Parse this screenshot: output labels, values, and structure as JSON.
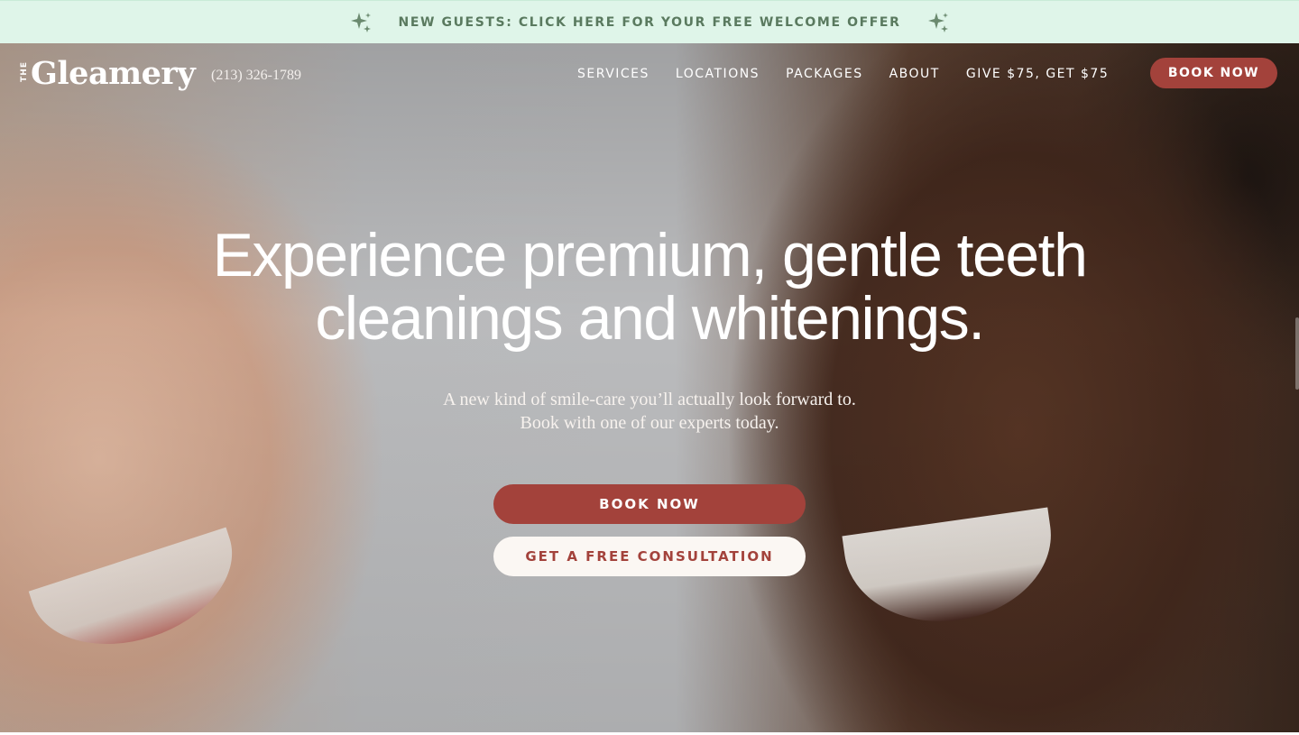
{
  "promo": {
    "text": "NEW GUESTS: CLICK HERE FOR YOUR FREE WELCOME OFFER",
    "icon": "sparkle-icon",
    "color": "#5a7a5f",
    "background": "#dff5e9"
  },
  "nav": {
    "logo_prefix": "THE",
    "logo_name": "Gleamery",
    "phone": "(213) 326-1789",
    "links": [
      "SERVICES",
      "LOCATIONS",
      "PACKAGES",
      "ABOUT",
      "GIVE $75, GET $75"
    ],
    "book_label": "BOOK NOW"
  },
  "hero": {
    "headline_line1": "Experience premium, gentle teeth",
    "headline_line2": "cleanings and whitenings.",
    "sub_line1": "A new kind of smile-care you’ll actually look forward to.",
    "sub_line2": "Book with one of our experts today.",
    "primary_cta": "BOOK NOW",
    "secondary_cta": "GET A FREE CONSULTATION"
  },
  "colors": {
    "brand_accent": "#a3423b",
    "button_light": "#fbf7f3"
  }
}
